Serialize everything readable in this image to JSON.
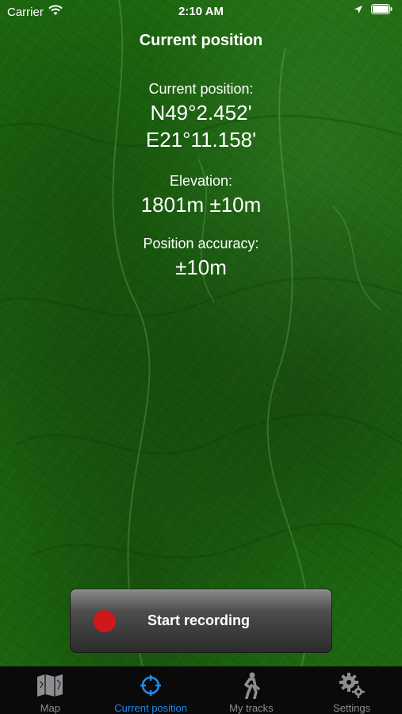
{
  "status_bar": {
    "carrier": "Carrier",
    "time": "2:10 AM"
  },
  "screen": {
    "title": "Current position"
  },
  "position": {
    "label": "Current position:",
    "latitude": "N49°2.452'",
    "longitude": "E21°11.158'"
  },
  "elevation": {
    "label": "Elevation:",
    "value": "1801m ±10m"
  },
  "accuracy": {
    "label": "Position accuracy:",
    "value": "±10m"
  },
  "record_button": {
    "label": "Start recording",
    "dot_color": "#d0171b"
  },
  "tab_bar": {
    "active_color": "#1e8cf0",
    "tabs": [
      {
        "label": "Map",
        "icon": "map-icon",
        "active": false
      },
      {
        "label": "Current position",
        "icon": "crosshair-icon",
        "active": true
      },
      {
        "label": "My tracks",
        "icon": "walking-person-icon",
        "active": false
      },
      {
        "label": "Settings",
        "icon": "gears-icon",
        "active": false
      }
    ]
  }
}
